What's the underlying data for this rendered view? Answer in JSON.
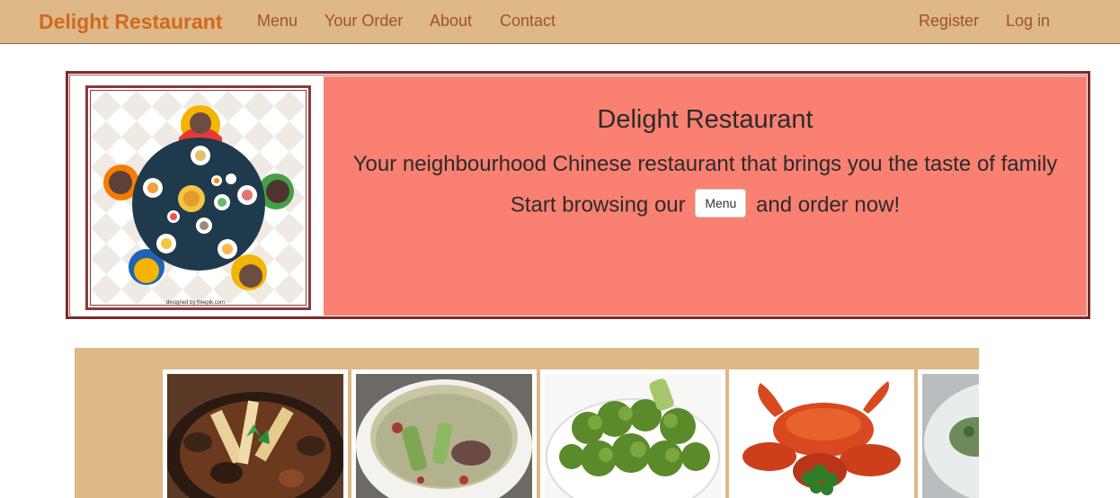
{
  "nav": {
    "brand": "Delight Restaurant",
    "links": [
      "Menu",
      "Your Order",
      "About",
      "Contact"
    ],
    "register": "Register",
    "login": "Log in"
  },
  "hero": {
    "title": "Delight Restaurant",
    "subtitle": "Your neighbourhood Chinese restaurant that brings you the taste of family",
    "cta_before": "Start browsing our",
    "cta_button": "Menu",
    "cta_after": "and order now!",
    "image_credit": "designed by freepik.com"
  },
  "gallery": {
    "items": [
      "claypot-braised-dish",
      "winter-melon-soup",
      "stir-fried-broccoli",
      "chilli-crab",
      "plated-dish"
    ]
  },
  "colors": {
    "navbar": "#deb887",
    "brand": "#d2691e",
    "nav_link": "#a0522d",
    "hero_panel": "#fa8072",
    "hero_border": "#7b2a2a",
    "gallery_bg": "#deb887"
  }
}
